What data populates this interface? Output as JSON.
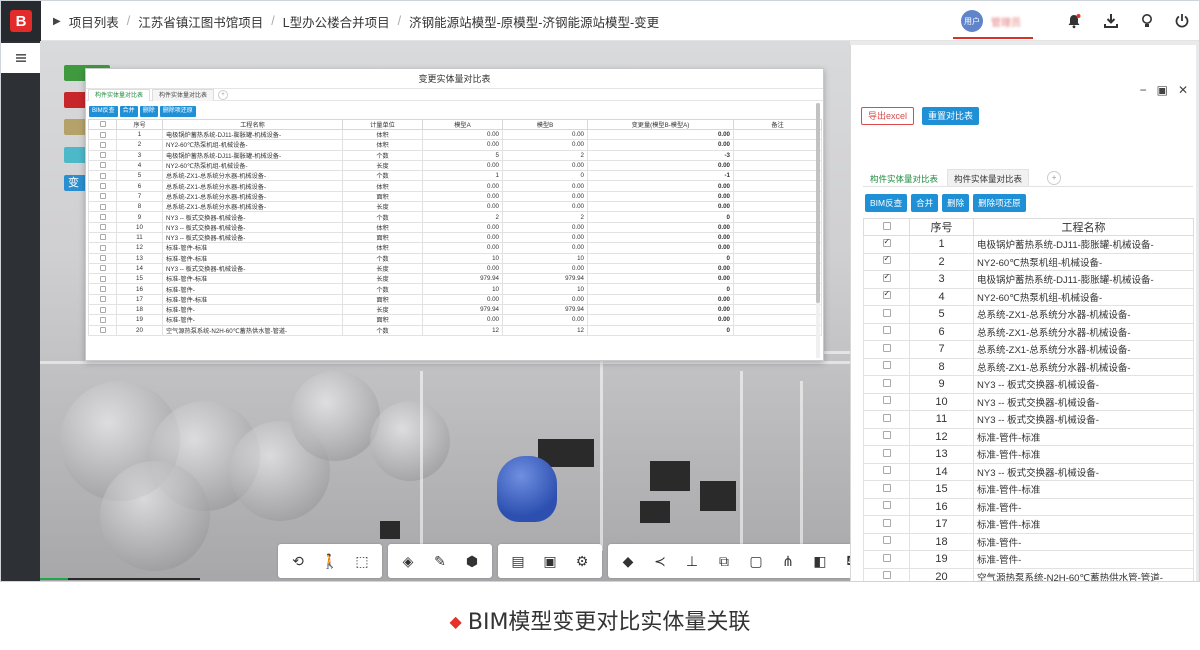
{
  "breadcrumb": {
    "items": [
      "项目列表",
      "江苏省镇江图书馆项目",
      "L型办公楼合并项目",
      "济钢能源站模型-原模型-济钢能源站模型-变更"
    ]
  },
  "user": {
    "avatar_text": "用户",
    "name": "管理员"
  },
  "header_icons": [
    "bell-icon",
    "download-icon",
    "lightbulb-icon",
    "power-icon"
  ],
  "viewport": {
    "side_label": "变",
    "side_colors": [
      "#3f9a3f",
      "#c7262a",
      "#b5a26a",
      "#4cb8c8",
      "#2a8fd0"
    ]
  },
  "toolbar_icons": [
    [
      "orbit-icon",
      "person-icon",
      "zoom-area-icon"
    ],
    [
      "section-box-icon",
      "measure-icon",
      "cube-icon"
    ],
    [
      "document-icon",
      "properties-icon",
      "settings-icon"
    ],
    [
      "layers-icon",
      "share-icon",
      "stamp-icon",
      "overlap-icon",
      "frame-icon",
      "tree-icon",
      "section-plane-icon",
      "paint-icon",
      "fullscreen-icon"
    ]
  ],
  "dialog": {
    "title": "变更实体量对比表",
    "tabs": [
      "构件实体量对比表",
      "构件实体量对比表"
    ],
    "buttons": [
      "BIM反查",
      "合并",
      "删除",
      "删除项还原"
    ],
    "headers": [
      "序号",
      "工程名称",
      "计量单位",
      "模型A",
      "模型B",
      "变更量(模型B-模型A)",
      "备注"
    ],
    "rows": [
      [
        "1",
        "电极锅炉蓄热系统-DJ11-膨胀罐-机械设备-",
        "体积",
        "0.00",
        "0.00",
        "0.00"
      ],
      [
        "2",
        "NY2-60℃热泵机组-机械设备-",
        "体积",
        "0.00",
        "0.00",
        "0.00"
      ],
      [
        "3",
        "电极锅炉蓄热系统-DJ11-膨胀罐-机械设备-",
        "个数",
        "5",
        "2",
        "-3"
      ],
      [
        "4",
        "NY2-60℃热泵机组-机械设备-",
        "长度",
        "0.00",
        "0.00",
        "0.00"
      ],
      [
        "5",
        "总系统-ZX1-总系统分水器-机械设备-",
        "个数",
        "1",
        "0",
        "-1"
      ],
      [
        "6",
        "总系统-ZX1-总系统分水器-机械设备-",
        "体积",
        "0.00",
        "0.00",
        "0.00"
      ],
      [
        "7",
        "总系统-ZX1-总系统分水器-机械设备-",
        "面积",
        "0.00",
        "0.00",
        "0.00"
      ],
      [
        "8",
        "总系统-ZX1-总系统分水器-机械设备-",
        "长度",
        "0.00",
        "0.00",
        "0.00"
      ],
      [
        "9",
        "NY3 -- 板式交换器-机械设备-",
        "个数",
        "2",
        "2",
        "0"
      ],
      [
        "10",
        "NY3 -- 板式交换器-机械设备-",
        "体积",
        "0.00",
        "0.00",
        "0.00"
      ],
      [
        "11",
        "NY3 -- 板式交换器-机械设备-",
        "面积",
        "0.00",
        "0.00",
        "0.00"
      ],
      [
        "12",
        "标准-管件-标准",
        "体积",
        "0.00",
        "0.00",
        "0.00"
      ],
      [
        "13",
        "标准-管件-标准",
        "个数",
        "10",
        "10",
        "0"
      ],
      [
        "14",
        "NY3 -- 板式交换器-机械设备-",
        "长度",
        "0.00",
        "0.00",
        "0.00"
      ],
      [
        "15",
        "标准-管件-标准",
        "长度",
        "979.94",
        "979.94",
        "0.00"
      ],
      [
        "16",
        "标准-管件-",
        "个数",
        "10",
        "10",
        "0"
      ],
      [
        "17",
        "标准-管件-标准",
        "面积",
        "0.00",
        "0.00",
        "0.00"
      ],
      [
        "18",
        "标准-管件-",
        "长度",
        "979.94",
        "979.94",
        "0.00"
      ],
      [
        "19",
        "标准-管件-",
        "面积",
        "0.00",
        "0.00",
        "0.00"
      ],
      [
        "20",
        "空气源热泵系统-N2H-60℃蓄热供水管-管道-",
        "个数",
        "12",
        "12",
        "0"
      ]
    ]
  },
  "panel": {
    "export_label": "导出excel",
    "reset_label": "重置对比表",
    "tabs": [
      "构件实体量对比表",
      "构件实体量对比表"
    ],
    "buttons": [
      "BIM反查",
      "合并",
      "删除",
      "删除项还原"
    ],
    "headers": [
      "序号",
      "工程名称"
    ],
    "rows": [
      {
        "no": "1",
        "name": "电极锅炉蓄热系统-DJ11-膨胀罐-机械设备-",
        "checked": true
      },
      {
        "no": "2",
        "name": "NY2-60℃热泵机组-机械设备-",
        "checked": true
      },
      {
        "no": "3",
        "name": "电极锅炉蓄热系统-DJ11-膨胀罐-机械设备-",
        "checked": true
      },
      {
        "no": "4",
        "name": "NY2-60℃热泵机组-机械设备-",
        "checked": true
      },
      {
        "no": "5",
        "name": "总系统-ZX1-总系统分水器-机械设备-",
        "checked": false
      },
      {
        "no": "6",
        "name": "总系统-ZX1-总系统分水器-机械设备-",
        "checked": false
      },
      {
        "no": "7",
        "name": "总系统-ZX1-总系统分水器-机械设备-",
        "checked": false
      },
      {
        "no": "8",
        "name": "总系统-ZX1-总系统分水器-机械设备-",
        "checked": false
      },
      {
        "no": "9",
        "name": "NY3 -- 板式交换器-机械设备-",
        "checked": false
      },
      {
        "no": "10",
        "name": "NY3 -- 板式交换器-机械设备-",
        "checked": false
      },
      {
        "no": "11",
        "name": "NY3 -- 板式交换器-机械设备-",
        "checked": false
      },
      {
        "no": "12",
        "name": "标准-管件-标准",
        "checked": false
      },
      {
        "no": "13",
        "name": "标准-管件-标准",
        "checked": false
      },
      {
        "no": "14",
        "name": "NY3 -- 板式交换器-机械设备-",
        "checked": false
      },
      {
        "no": "15",
        "name": "标准-管件-标准",
        "checked": false
      },
      {
        "no": "16",
        "name": "标准-管件-",
        "checked": false
      },
      {
        "no": "17",
        "name": "标准-管件-标准",
        "checked": false
      },
      {
        "no": "18",
        "name": "标准-管件-",
        "checked": false
      },
      {
        "no": "19",
        "name": "标准-管件-",
        "checked": false
      },
      {
        "no": "20",
        "name": "空气源热泵系统-N2H-60℃蓄热供水管-管道-",
        "checked": false
      }
    ]
  },
  "caption": "BIM模型变更对比实体量关联",
  "colors": {
    "accent_blue": "#1f8fd6",
    "accent_red": "#e3342a",
    "tab_active_green": "#1d8a3e"
  }
}
